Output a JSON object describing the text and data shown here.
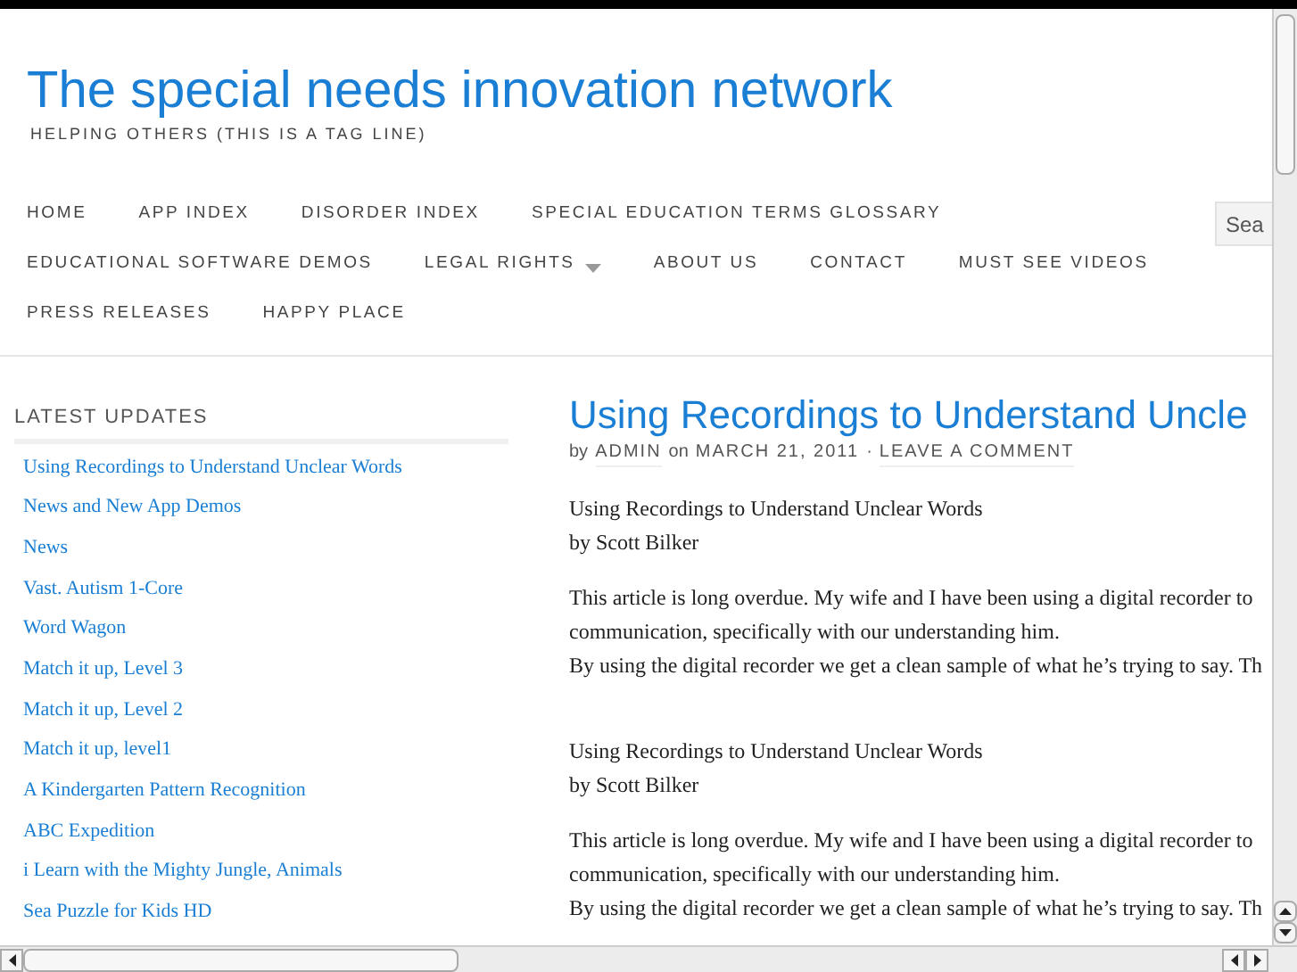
{
  "site": {
    "title": "The special needs innovation network",
    "tagline": "HELPING OTHERS (THIS IS A TAG LINE)"
  },
  "nav": {
    "items": [
      {
        "label": "HOME",
        "has_submenu": false
      },
      {
        "label": "APP INDEX",
        "has_submenu": false
      },
      {
        "label": "DISORDER INDEX",
        "has_submenu": false
      },
      {
        "label": "SPECIAL EDUCATION TERMS GLOSSARY",
        "has_submenu": false
      },
      {
        "label": "EDUCATIONAL SOFTWARE DEMOS",
        "has_submenu": false
      },
      {
        "label": "LEGAL RIGHTS",
        "has_submenu": true
      },
      {
        "label": "ABOUT US",
        "has_submenu": false
      },
      {
        "label": "CONTACT",
        "has_submenu": false
      },
      {
        "label": "MUST SEE VIDEOS",
        "has_submenu": false
      },
      {
        "label": "PRESS RELEASES",
        "has_submenu": false
      },
      {
        "label": "HAPPY PLACE",
        "has_submenu": false
      }
    ],
    "search": {
      "placeholder": "Sea"
    }
  },
  "sidebar": {
    "heading": "LATEST UPDATES",
    "links": [
      "Using Recordings to Understand Unclear Words",
      "News and New App Demos",
      "News",
      "Vast. Autism 1-Core",
      "Word Wagon",
      "Match it up, Level 3",
      "Match it up, Level 2",
      "Match it up, level1",
      "A Kindergarten Pattern Recognition",
      "ABC Expedition",
      "i Learn with the Mighty Jungle, Animals",
      "Sea Puzzle for Kids HD"
    ]
  },
  "post": {
    "title": "Using Recordings to Understand Uncle",
    "meta": {
      "by": "by",
      "author": "ADMIN",
      "on": "on",
      "date": "MARCH 21, 2011",
      "separator": "·",
      "comments": "LEAVE A COMMENT"
    },
    "blocks": [
      {
        "lines": [
          "Using Recordings to Understand Unclear Words",
          "by Scott Bilker"
        ]
      },
      {
        "lines": [
          "This article is long overdue. My wife and I have been using a digital recorder to",
          "communication, specifically with our understanding him.",
          "By using the digital recorder we get a clean sample of what he’s trying to say. Th"
        ]
      },
      {
        "lines": [
          "Using Recordings to Understand Unclear Words",
          "by Scott Bilker"
        ]
      },
      {
        "lines": [
          "This article is long overdue. My wife and I have been using a digital recorder to",
          "communication, specifically with our understanding him.",
          "By using the digital recorder we get a clean sample of what he’s trying to say. Th"
        ]
      }
    ]
  }
}
